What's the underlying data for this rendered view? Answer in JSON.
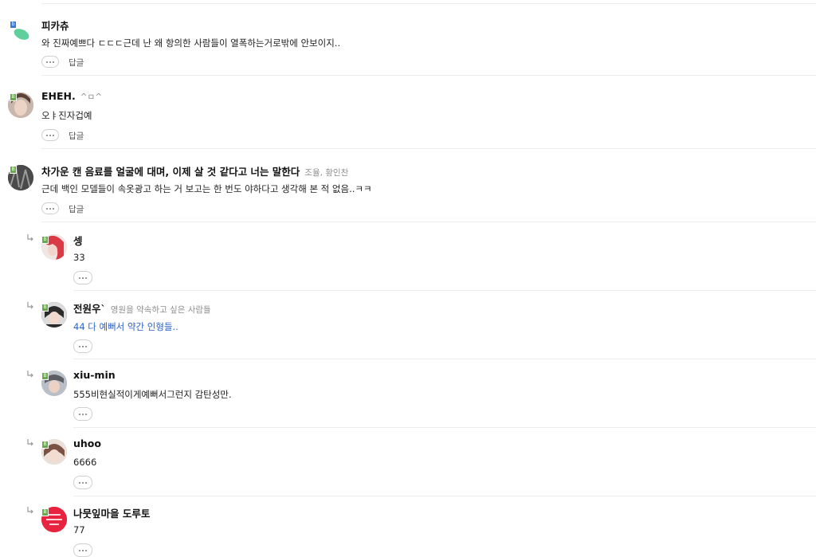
{
  "ui": {
    "more_label": "⋯",
    "reply_label": "답글"
  },
  "comments": [
    {
      "name": "피카츄",
      "subtitle": "",
      "level": "b",
      "text": "와 진짜예쁘다 ㄷㄷㄷ근데 난 왜 항의한 사람들이 열폭하는거로밖에 안보이지..",
      "avatar": "leaf-icon"
    },
    {
      "name": "EHEH.",
      "subtitle": "^ㅁ^",
      "level": "B",
      "text": "오ㅑ진자겁예",
      "avatar": "user-photo"
    },
    {
      "name": "차가운 캔 음료를 얼굴에 대며, 이제 살 것 같다고 너는 말한다",
      "subtitle": "조율, 황인찬",
      "level": "B",
      "text": "근데 백인 모델들이 속옷광고 하는 거 보고는 한 번도 야하다고 생각해 본 적 없음..ㅋㅋ",
      "avatar": "user-photo"
    }
  ],
  "replies": [
    {
      "name": "셍",
      "subtitle": "",
      "level": "B",
      "text": "33",
      "text_color": "#222222",
      "avatar": "user-photo"
    },
    {
      "name": "전원우`",
      "subtitle": "영원을 약속하고 싶은 사람들",
      "level": "B",
      "text": "44 다 예뻐서 약간 인형들..",
      "text_color": "#2c62c4",
      "avatar": "user-photo"
    },
    {
      "name": "xiu-min",
      "subtitle": "",
      "level": "B",
      "text": "555비현실적이게예뻐서그런지 감탄성만.",
      "text_color": "#222222",
      "avatar": "user-photo"
    },
    {
      "name": "uhoo",
      "subtitle": "",
      "level": "B",
      "text": "6666",
      "text_color": "#222222",
      "avatar": "user-photo"
    },
    {
      "name": "나뭇잎마을 도루토",
      "subtitle": "",
      "level": "B",
      "text": "77",
      "text_color": "#222222",
      "avatar": "user-photo"
    }
  ]
}
